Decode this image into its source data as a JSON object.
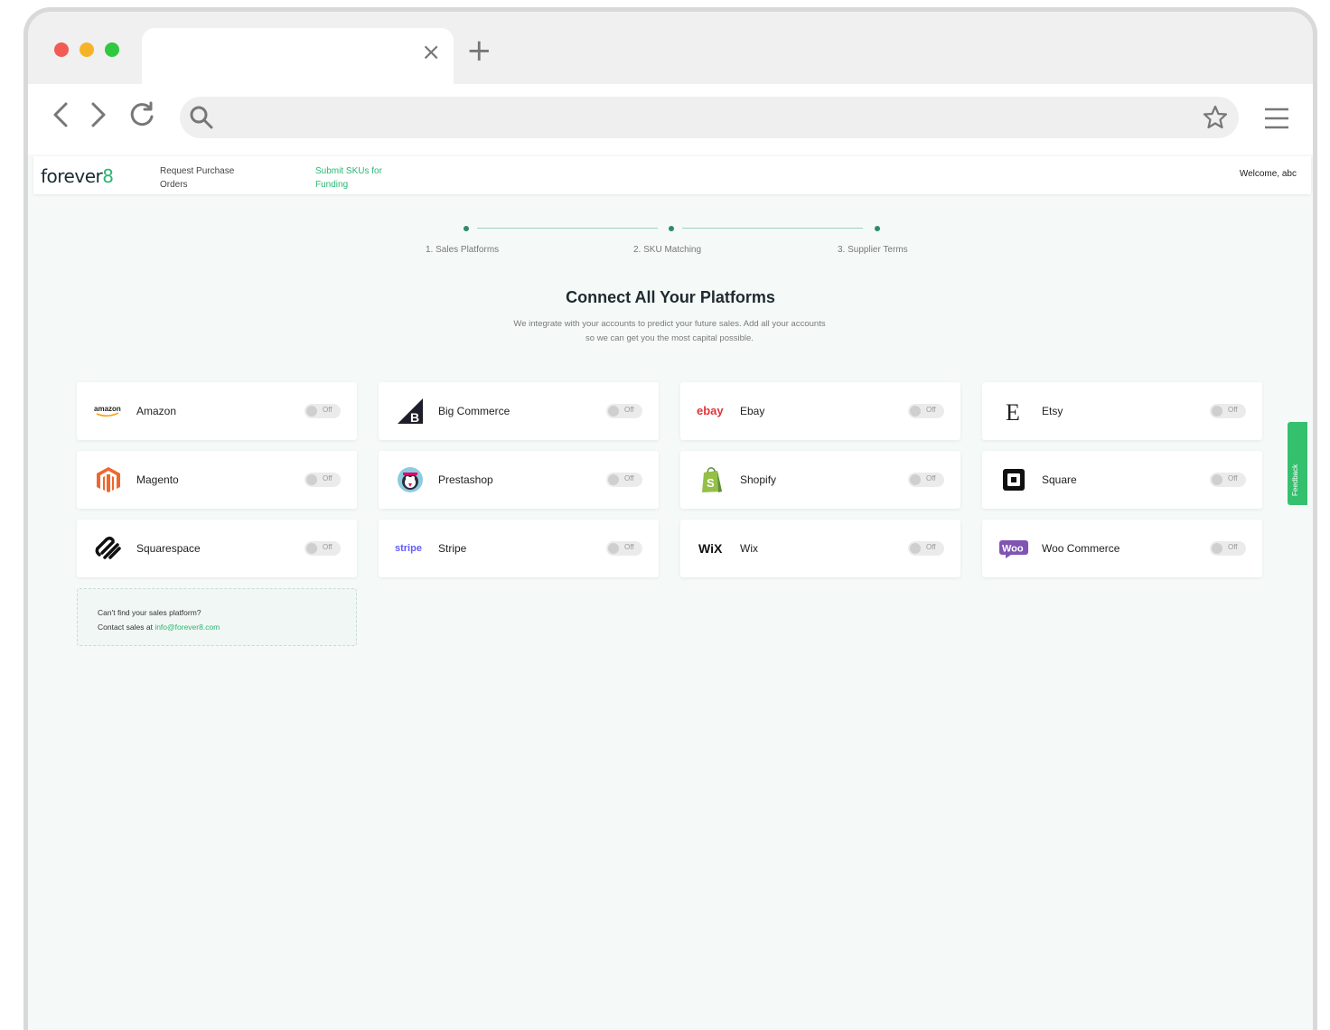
{
  "browser": {
    "tab_close_glyph": "×",
    "new_tab_glyph": "+",
    "icons": [
      "back-icon",
      "forward-icon",
      "reload-icon",
      "search-icon",
      "star-icon",
      "menu-icon"
    ]
  },
  "app": {
    "logo_main": "forever",
    "logo_accent": "8",
    "nav": [
      {
        "line1": "Request Purchase",
        "line2": "Orders"
      },
      {
        "line1": "Submit SKUs for",
        "line2": "Funding"
      }
    ],
    "welcome": "Welcome, abc",
    "accent_color": "#2bb673"
  },
  "stepper": {
    "steps": [
      "1. Sales Platforms",
      "2. SKU Matching",
      "3. Supplier Terms"
    ]
  },
  "heading": "Connect All Your Platforms",
  "subtext_line1": "We integrate with your accounts to predict your future sales. Add all your accounts",
  "subtext_line2": "so we can get you the most capital possible.",
  "platforms": [
    {
      "name": "Amazon",
      "toggle": "Off",
      "logo_text": "amazon"
    },
    {
      "name": "Big Commerce",
      "toggle": "Off"
    },
    {
      "name": "Ebay",
      "toggle": "Off",
      "logo_text": "ebay"
    },
    {
      "name": "Etsy",
      "toggle": "Off",
      "logo_text": "E"
    },
    {
      "name": "Magento",
      "toggle": "Off"
    },
    {
      "name": "Prestashop",
      "toggle": "Off"
    },
    {
      "name": "Shopify",
      "toggle": "Off"
    },
    {
      "name": "Square",
      "toggle": "Off"
    },
    {
      "name": "Squarespace",
      "toggle": "Off"
    },
    {
      "name": "Stripe",
      "toggle": "Off",
      "logo_text": "stripe"
    },
    {
      "name": "Wix",
      "toggle": "Off",
      "logo_text": "WiX"
    },
    {
      "name": "Woo Commerce",
      "toggle": "Off",
      "logo_text": "Woo"
    }
  ],
  "help": {
    "line1": "Can't find your sales platform?",
    "line2_prefix": "Contact sales at ",
    "email": "info@forever8.com"
  },
  "feedback_label": "Feedback"
}
